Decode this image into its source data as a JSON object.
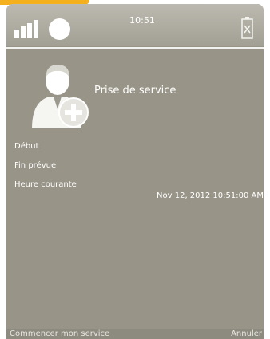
{
  "statusbar": {
    "time": "10:51",
    "icons": [
      "signal-icon",
      "status-dot-icon",
      "battery-icon"
    ]
  },
  "header": {
    "title": "Prise de service",
    "icon": "user-add-icon"
  },
  "fields": {
    "start_label": "Début",
    "planned_end_label": "Fin prévue",
    "current_time_label": "Heure courante",
    "current_time_value": "Nov 12, 2012 10:51:00 AM"
  },
  "softkeys": {
    "left": "Commencer mon service",
    "right": "Annuler"
  },
  "colors": {
    "accent": "#f5b01e",
    "screen_bg": "#989588",
    "text": "#ffffff"
  }
}
